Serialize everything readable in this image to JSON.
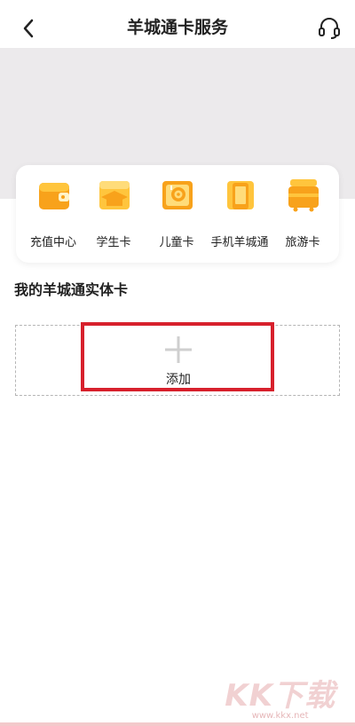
{
  "header": {
    "title": "羊城通卡服务",
    "back_icon": "chevron-left-icon",
    "support_icon": "headset-icon"
  },
  "services": [
    {
      "label": "充值中心",
      "icon": "wallet-icon"
    },
    {
      "label": "学生卡",
      "icon": "graduation-cap-icon"
    },
    {
      "label": "儿童卡",
      "icon": "lollipop-icon"
    },
    {
      "label": "手机羊城通",
      "icon": "phone-card-icon"
    },
    {
      "label": "旅游卡",
      "icon": "luggage-icon"
    }
  ],
  "section": {
    "title": "我的羊城通实体卡"
  },
  "add_card": {
    "label": "添加"
  },
  "watermark": {
    "main": "KK下载",
    "url": "www.kkx.net"
  },
  "colors": {
    "accent": "#f5a623",
    "highlight": "#d7202c",
    "banner": "#eceaec"
  }
}
